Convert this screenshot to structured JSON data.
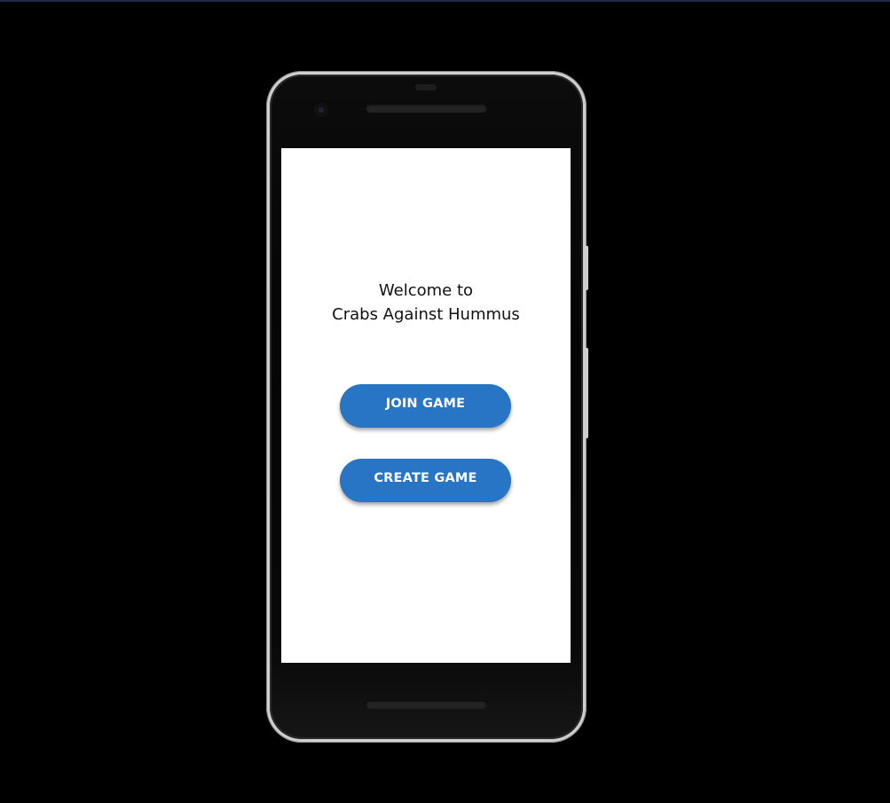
{
  "screen": {
    "welcome_line1": "Welcome to",
    "welcome_line2": "Crabs Against Hummus",
    "join_label": "JOIN GAME",
    "create_label": "CREATE GAME"
  },
  "colors": {
    "background": "#000000",
    "screen": "#ffffff",
    "button": "#2775c4",
    "button_text": "#ffffff",
    "phone_frame": "#cfcfcf"
  },
  "icons": [
    "camera-icon"
  ]
}
